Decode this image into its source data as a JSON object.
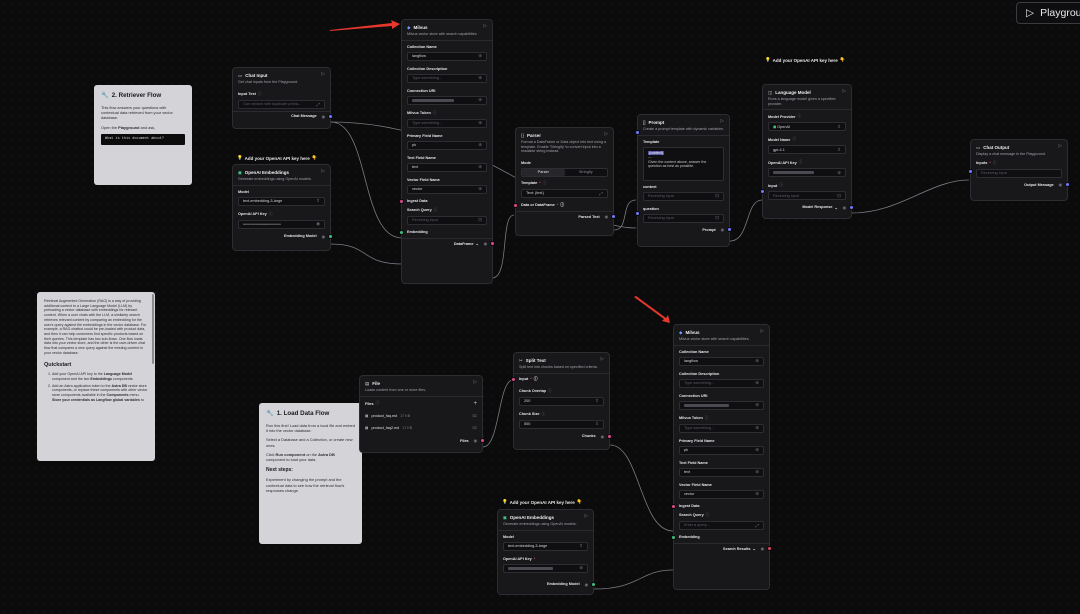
{
  "playground": {
    "label": "Playground",
    "icon": "play-icon"
  },
  "annotations": {
    "api_key_1": "Add your OpenAI API key here",
    "api_key_2": "Add your OpenAI API key here",
    "api_key_3": "Add your OpenAI API key here"
  },
  "notes": {
    "retriever": {
      "title": "2. Retriever Flow",
      "p1": "This flow answers your questions with contextual data retrieved from your vector database.",
      "p2a": "Open the ",
      "p2b": "Playground",
      "p2c": " and ask,",
      "code": "What is this document about?"
    },
    "load": {
      "title": "1. Load Data Flow",
      "p1": "Run this first! Load data from a local file and embed it into the vector database.",
      "p2": "Select a Database and a Collection, or create new ones.",
      "p3a": "Click ",
      "p3b": "Run component",
      "p3c": " on the ",
      "p3d": "Astra DB",
      "p3e": " component to load your data.",
      "h": "Next steps:",
      "p4": "Experiment by changing the prompt and the contextual data to see how the retrieval flow's responses change."
    },
    "rag": {
      "p1": "Retrieval Augmented Generation (RAG) is a way of providing additional context to a Large Language Model (LLM) by preloading a vector database with embeddings for relevant content. When a user chats with the LLM, a similarity search retrieves relevant content by comparing an embedding for the user's query against the embeddings in the vector database. For example, a RAG chatbot could be pre-loaded with product data, and then it can help customers find specific products based on their queries. This template has two sub-flows. One flow loads data into your vector store, and the other is the user-driven chat flow that compares a new query against the existing content in your vector database.",
      "h": "Quickstart",
      "li1a": "Add your OpenAI API key to the ",
      "li1b": "Language Model",
      "li1c": " component and the two ",
      "li1d": "Embeddings",
      "li1e": " components.",
      "li2a": "Add an Astra application token to the ",
      "li2b": "Astra DB",
      "li2c": " vector store components, or replace these components with other vector store components available in the ",
      "li2d": "Components",
      "li2e": " menu. ",
      "li2f": "Store your credentials as Langflow global variables",
      "li2g": " to"
    }
  },
  "chat_input": {
    "title": "Chat Input",
    "desc": "Get chat inputs from the Playground.",
    "field": "Input Text",
    "placeholder": "Can vectors with duplicate prima...",
    "output": "Chat Message"
  },
  "emb1": {
    "title": "OpenAI Embeddings",
    "desc": "Generate embeddings using OpenAI models.",
    "model_label": "Model",
    "model": "text-embedding-3-large",
    "key_label": "OpenAI API Key",
    "key": "••••••••••••••••••••••••••••••••••••",
    "output": "Embedding Model"
  },
  "milvus1": {
    "title": "Milvus",
    "desc": "Milvus vector store with search capabilities",
    "f1": "Collection Name",
    "v1": "langflow",
    "f2": "Collection Description",
    "p2": "Type something...",
    "f3": "Connection URI",
    "f4": "Milvus Token",
    "p4": "Type something...",
    "f5": "Primary Field Name",
    "v5": "pk",
    "f6": "Text Field Name",
    "v6": "text",
    "f7": "Vector Field Name",
    "v7": "vector",
    "in1": "Ingest Data",
    "in2": "Search Query",
    "p_in2": "Receiving input",
    "in3": "Embedding",
    "output": "DataFrame"
  },
  "parser": {
    "title": "Parser",
    "desc": "Format a DataFrame or Data object into text using a template. Enable 'Stringify' to convert input into a readable string instead.",
    "mode": "Mode",
    "opt1": "Parser",
    "opt2": "Stringify",
    "tmpl_label": "Template",
    "tmpl_val": "Text: {text}",
    "in": "Data or DataFrame",
    "output": "Parsed Text"
  },
  "prompt": {
    "title": "Prompt",
    "desc": "Create a prompt template with dynamic variables.",
    "tmpl_label": "Template",
    "tmpl_var": "{context}",
    "tmpl_dash": "---",
    "tmpl_text": "Given the context above, answer the question as best as possible.",
    "v1": "context",
    "v2": "question",
    "recv": "Receiving input",
    "output": "Prompt"
  },
  "lm": {
    "title": "Language Model",
    "desc": "Runs a language model given a specified provider.",
    "f1": "Model Provider",
    "v1": "OpenAI",
    "f2": "Model Name",
    "v2": "gpt-4.1",
    "f3": "OpenAI API Key",
    "f4": "Input",
    "p4": "Receiving input",
    "output": "Model Response"
  },
  "chat_output": {
    "title": "Chat Output",
    "desc": "Display a chat message in the Playground.",
    "f1": "Inputs",
    "p1": "Receiving input",
    "output": "Output Message"
  },
  "file": {
    "title": "File",
    "desc": "Loads content from one or more files.",
    "label": "Files",
    "file1": "product_faq.md",
    "size1": "17 KB",
    "file2": "product_faq2.md",
    "size2": "17 KB",
    "output": "Files"
  },
  "split": {
    "title": "Split Text",
    "desc": "Split text into chunks based on specified criteria.",
    "in": "Input",
    "f1": "Chunk Overlap",
    "v1": "200",
    "f2": "Chunk Size",
    "v2": "500",
    "output": "Chunks"
  },
  "emb2": {
    "title": "OpenAI Embeddings",
    "desc": "Generate embeddings using OpenAI models.",
    "model_label": "Model",
    "model": "text-embedding-3-large",
    "key_label": "OpenAI API Key",
    "output": "Embedding Model"
  },
  "milvus2": {
    "title": "Milvus",
    "desc": "Milvus vector store with search capabilities.",
    "f1": "Collection Name",
    "v1": "langflow",
    "f2": "Collection Description",
    "p2": "Type something...",
    "f3": "Connection URI",
    "f4": "Milvus Token",
    "p4": "Type something...",
    "f5": "Primary Field Name",
    "v5": "pk",
    "f6": "Text Field Name",
    "v6": "text",
    "f7": "Vector Field Name",
    "v7": "vector",
    "in1": "Ingest Data",
    "in2": "Search Query",
    "p_in2": "Enter a query...",
    "in3": "Embedding",
    "output": "Search Results"
  },
  "colors": {
    "edge": "#8a8a92",
    "data_handle": "#e04a8a",
    "message_handle": "#6f7cff",
    "embedding_handle": "#3fbf7f",
    "arrow": "#e8372c"
  }
}
